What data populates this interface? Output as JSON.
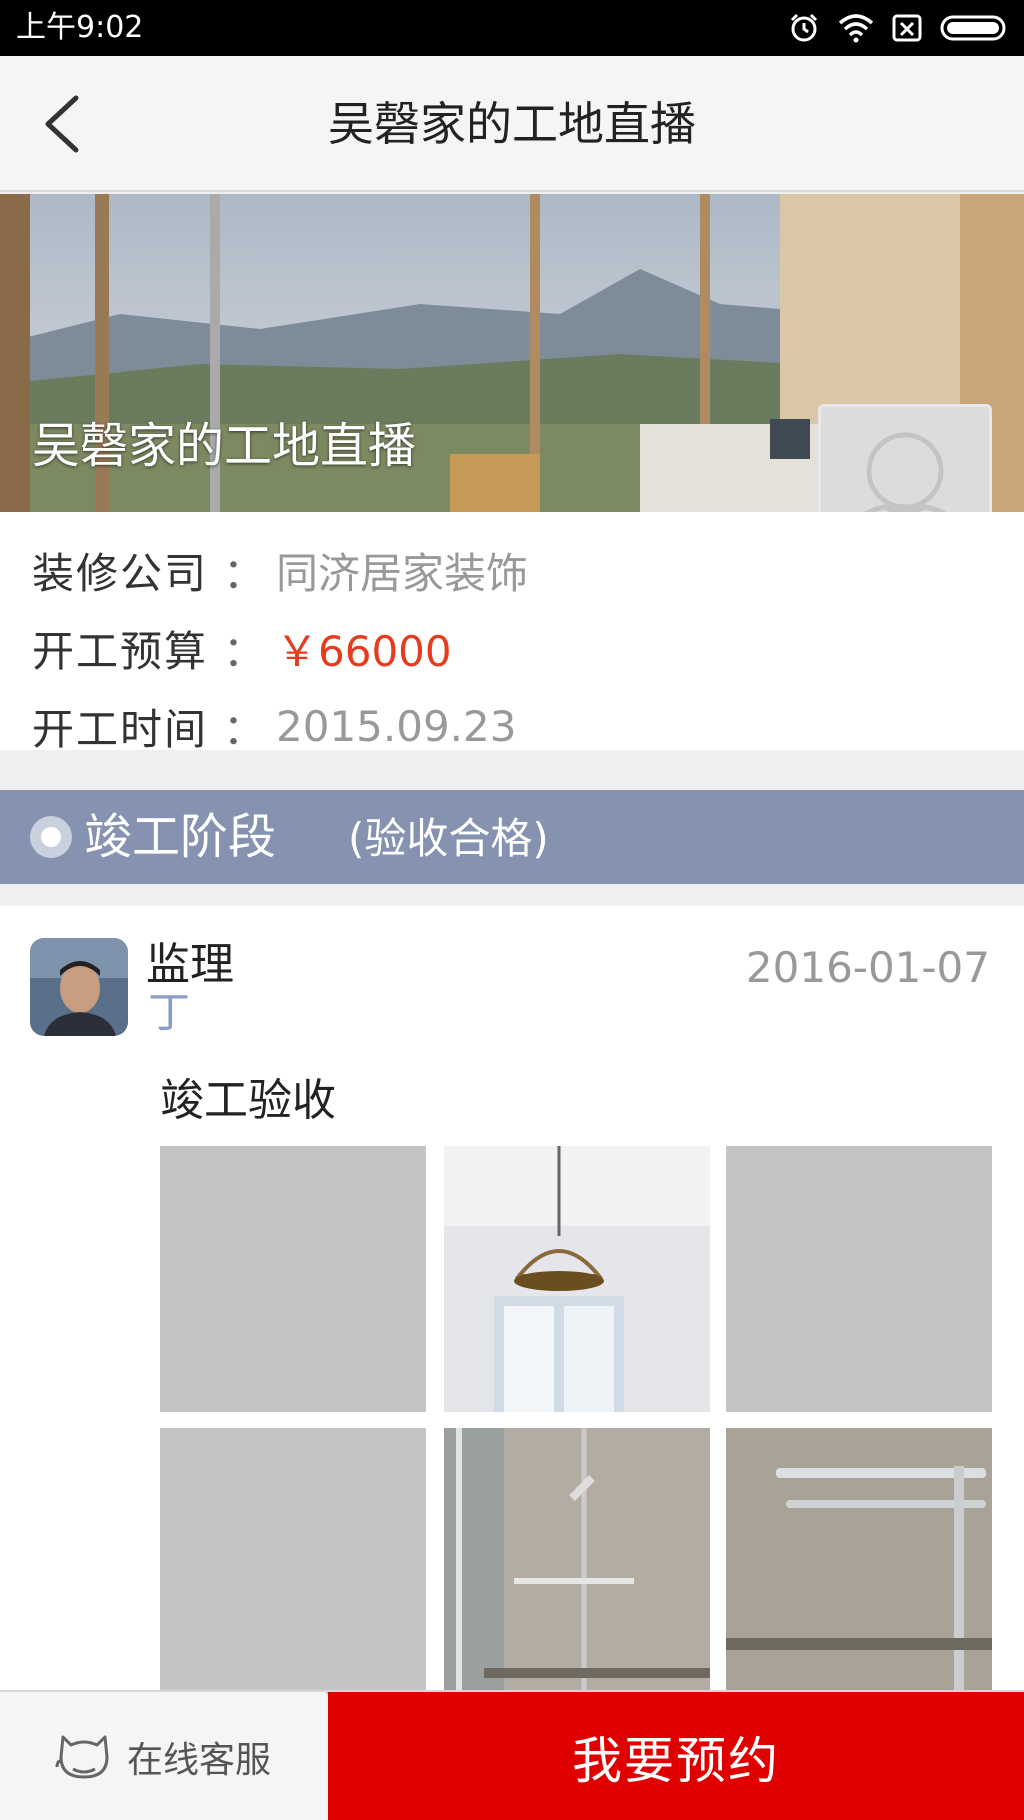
{
  "status_bar": {
    "time": "上午9:02"
  },
  "nav": {
    "title": "吴磬家的工地直播"
  },
  "hero": {
    "title": "吴磬家的工地直播"
  },
  "info": {
    "company_label": "装修公司",
    "company_value": "同济居家装饰",
    "budget_label": "开工预算",
    "budget_value": "￥66000",
    "start_label": "开工时间",
    "start_value": "2015.09.23",
    "colon": "："
  },
  "stage": {
    "name": "竣工阶段",
    "status": "(验收合格)"
  },
  "post": {
    "role": "监理",
    "author": "丁",
    "date": "2016-01-07",
    "content": "竣工验收"
  },
  "bottom": {
    "service_label": "在线客服",
    "reserve_label": "我要预约"
  },
  "colors": {
    "accent_red": "#e00000",
    "stage_blue": "#8593b1",
    "price_red": "#e53b1e"
  }
}
